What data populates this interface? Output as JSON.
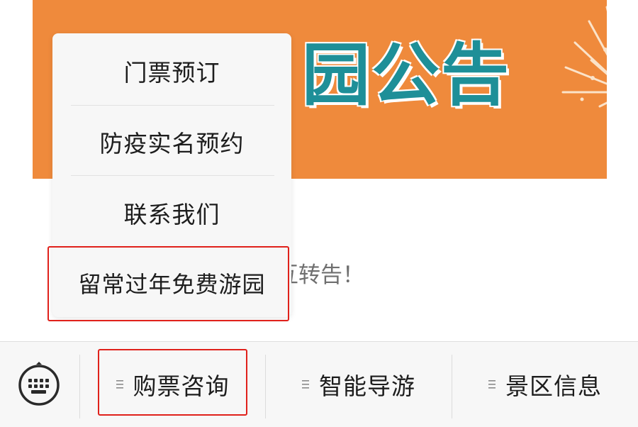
{
  "banner": {
    "title_partial": "园公告",
    "background_color": "#ef8a3c",
    "title_color": "#1e8f98"
  },
  "notice": {
    "text_partial": "互转告！"
  },
  "popup_menu": {
    "items": [
      {
        "label": "门票预订"
      },
      {
        "label": "防疫实名预约"
      },
      {
        "label": "联系我们"
      },
      {
        "label": "留常过年免费游园"
      }
    ]
  },
  "bottom_bar": {
    "keyboard_icon": "keyboard-icon",
    "menu_icon": "menu-lines-icon",
    "items": [
      {
        "label": "购票咨询"
      },
      {
        "label": "智能导游"
      },
      {
        "label": "景区信息"
      }
    ]
  },
  "highlight_color": "#e0211b"
}
